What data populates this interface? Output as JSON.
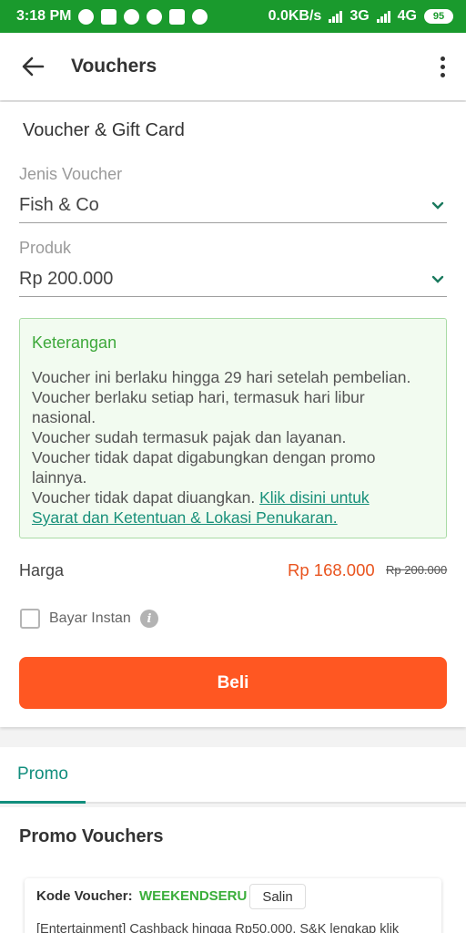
{
  "status_bar": {
    "time": "3:18 PM",
    "net_speed": "0.0KB/s",
    "network1": "3G",
    "network2": "4G",
    "battery": "95"
  },
  "app_bar": {
    "title": "Vouchers",
    "back_icon": "arrow-left-icon",
    "more_icon": "more-vert-icon"
  },
  "form": {
    "section_title": "Voucher & Gift Card",
    "voucher_type": {
      "label": "Jenis Voucher",
      "value": "Fish & Co"
    },
    "product": {
      "label": "Produk",
      "value": "Rp 200.000"
    }
  },
  "info_box": {
    "title": "Keterangan",
    "lines": [
      "Voucher ini berlaku hingga 29 hari setelah pembelian.",
      "Voucher berlaku setiap hari, termasuk hari libur",
      "nasional.",
      "Voucher sudah termasuk pajak dan layanan.",
      "Voucher tidak dapat digabungkan dengan promo",
      "lainnya."
    ],
    "last_line_prefix": "Voucher tidak dapat diuangkan. ",
    "link_text_1": "Klik disini untuk",
    "link_text_2": "Syarat dan Ketentuan & Lokasi Penukaran."
  },
  "price": {
    "label": "Harga",
    "current": "Rp 168.000",
    "original": "Rp 200.000"
  },
  "instant_pay": {
    "label": "Bayar Instan",
    "checked": false
  },
  "buy_button": {
    "label": "Beli"
  },
  "tabs": [
    {
      "label": "Promo",
      "active": true
    }
  ],
  "promo": {
    "title": "Promo Vouchers",
    "items": [
      {
        "code_label": "Kode Voucher:",
        "code": "WEEKENDSERU",
        "copy_label": "Salin",
        "description": "[Entertainment] Cashback hingga Rp50.000. S&K lengkap klik"
      }
    ]
  },
  "colors": {
    "status_bar": "#1a9a2d",
    "accent_orange": "#ff5722",
    "price_red": "#e9541f",
    "teal": "#118e7d",
    "info_green": "#3da83a"
  }
}
